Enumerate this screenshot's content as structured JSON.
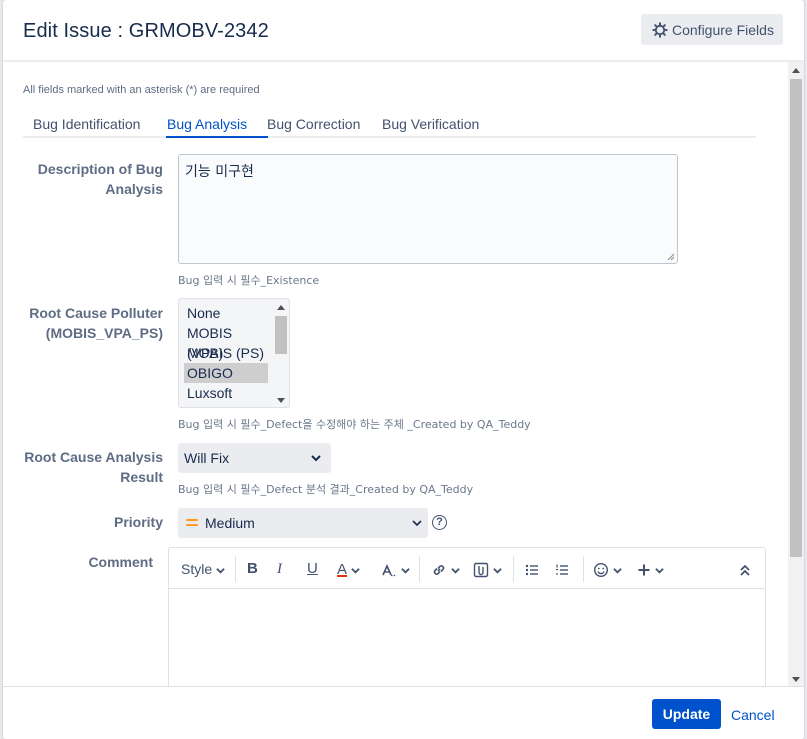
{
  "dialog": {
    "title": "Edit Issue : GRMOBV-2342",
    "configure_fields_label": "Configure Fields"
  },
  "form": {
    "required_note": "All fields marked with an asterisk (*) are required",
    "tabs": [
      {
        "label": "Bug Identification",
        "active": false
      },
      {
        "label": "Bug Analysis",
        "active": true
      },
      {
        "label": "Bug Correction",
        "active": false
      },
      {
        "label": "Bug Verification",
        "active": false
      }
    ],
    "description": {
      "label_line1": "Description of Bug",
      "label_line2": "Analysis",
      "value": "기능 미구현",
      "help": "Bug 입력 시 필수_Existence"
    },
    "root_cause_polluter": {
      "label_line1": "Root Cause Polluter",
      "label_line2": "(MOBIS_VPA_PS)",
      "options": [
        "None",
        "MOBIS (VPA)",
        "MOBIS (PS)",
        "OBIGO",
        "Luxsoft"
      ],
      "selected": "OBIGO",
      "help": "Bug 입력 시 필수_Defect을 수정해야 하는 주체 _Created by QA_Teddy"
    },
    "root_cause_result": {
      "label_line1": "Root Cause Analysis",
      "label_line2": "Result",
      "value": "Will Fix",
      "help": "Bug 입력 시 필수_Defect 분석 결과_Created by QA_Teddy"
    },
    "priority": {
      "label": "Priority",
      "value": "Medium",
      "help_icon": "question-circle-icon",
      "icon_color": "#ff991f"
    },
    "comment": {
      "label": "Comment",
      "toolbar": {
        "style_label": "Style",
        "bold": "B",
        "italic": "I",
        "underline": "U",
        "text_color": "A",
        "text_color_accent": "#de350b"
      }
    }
  },
  "footer": {
    "update_label": "Update",
    "cancel_label": "Cancel"
  },
  "colors": {
    "primary": "#0052cc",
    "text": "#172b4d",
    "muted": "#5e6c84"
  }
}
